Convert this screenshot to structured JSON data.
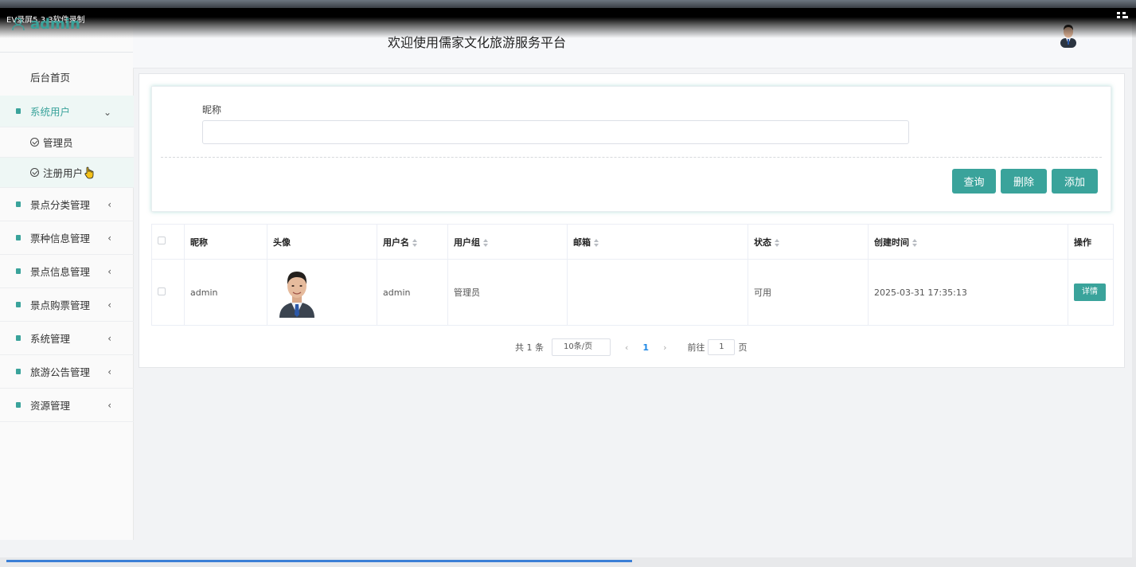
{
  "recorder": {
    "title": "EV录屏5.3.3软件录制"
  },
  "brand": {
    "name": "admin"
  },
  "header": {
    "title": "欢迎使用儒家文化旅游服务平台"
  },
  "sidebar": {
    "home": "后台首页",
    "items": [
      {
        "label": "系统用户",
        "expanded": true,
        "subs": [
          "管理员",
          "注册用户"
        ]
      },
      {
        "label": "景点分类管理"
      },
      {
        "label": "票种信息管理"
      },
      {
        "label": "景点信息管理"
      },
      {
        "label": "景点购票管理"
      },
      {
        "label": "系统管理"
      },
      {
        "label": "旅游公告管理"
      },
      {
        "label": "资源管理"
      }
    ]
  },
  "search": {
    "field_label": "昵称",
    "field_value": "",
    "buttons": {
      "query": "查询",
      "delete": "删除",
      "add": "添加"
    }
  },
  "table": {
    "headers": [
      "昵称",
      "头像",
      "用户名",
      "用户组",
      "邮箱",
      "状态",
      "创建时间",
      "操作"
    ],
    "rows": [
      {
        "nickname": "admin",
        "username": "admin",
        "group": "管理员",
        "email": "",
        "status": "可用",
        "created": "2025-03-31 17:35:13",
        "action": "详情"
      }
    ]
  },
  "pagination": {
    "total": "共 1 条",
    "page_size": "10条/页",
    "current": "1",
    "goto_label": "前往",
    "goto_value": "1",
    "page_suffix": "页"
  },
  "colors": {
    "accent": "#3aa39b"
  }
}
